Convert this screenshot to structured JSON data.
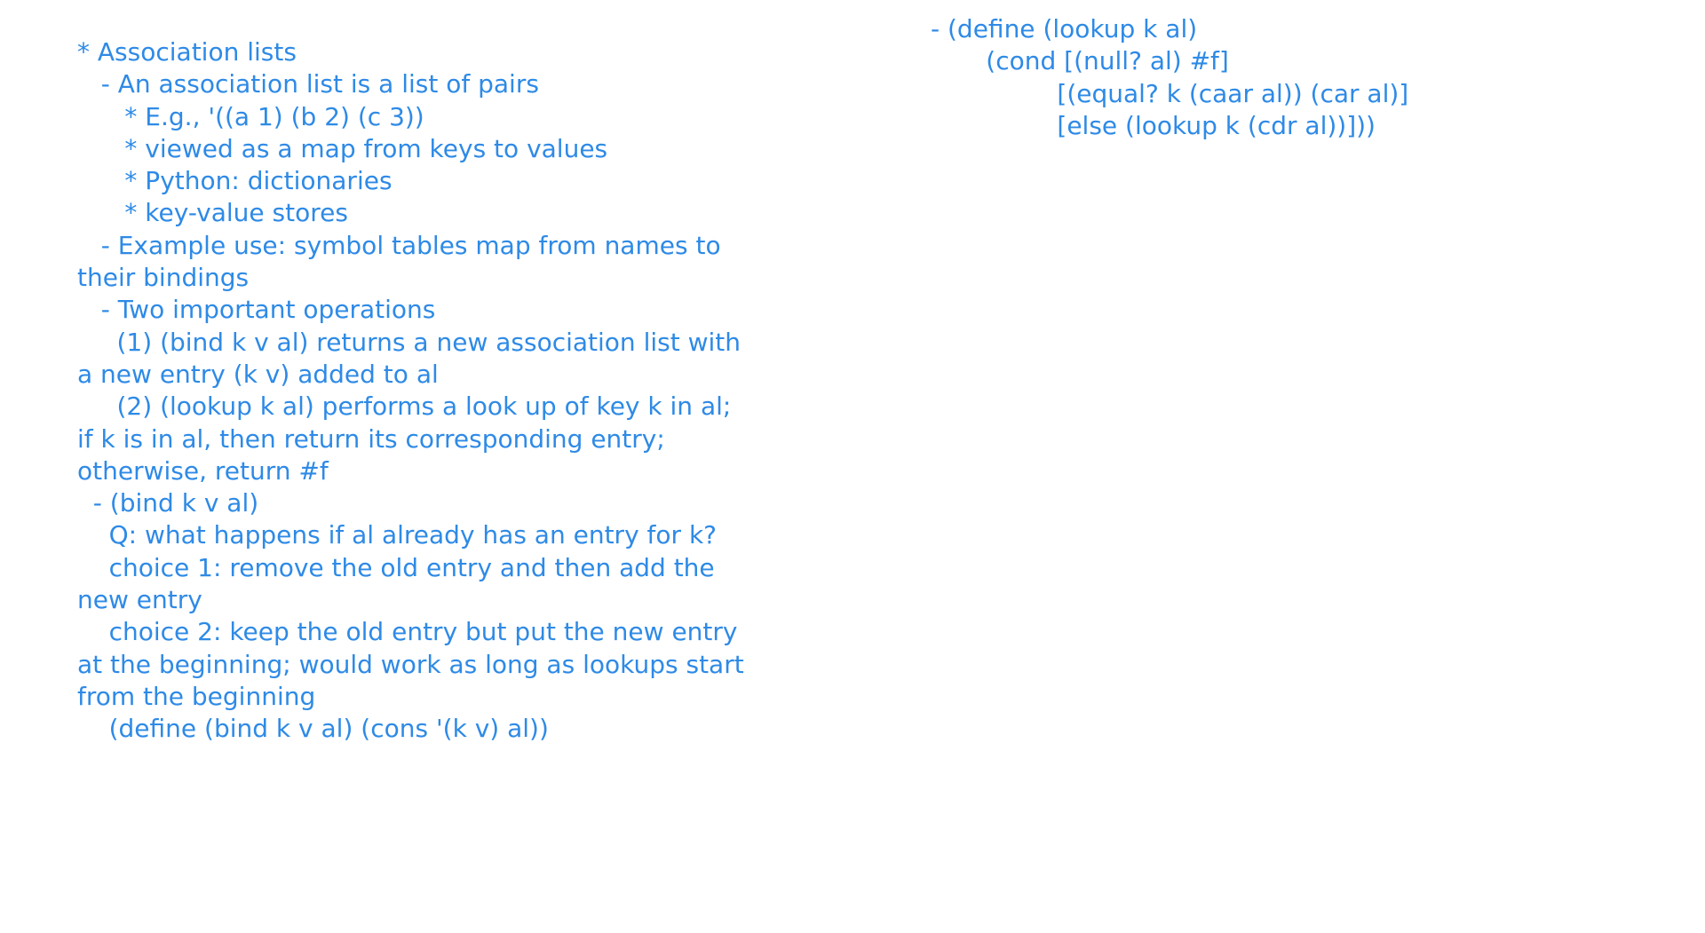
{
  "left_column": {
    "lines": [
      "* Association lists",
      "   - An association list is a list of pairs",
      "      * E.g., '((a 1) (b 2) (c 3))",
      "      * viewed as a map from keys to values",
      "      * Python: dictionaries",
      "      * key-value stores",
      "   - Example use: symbol tables map from names to",
      "their bindings",
      "   - Two important operations",
      "     (1) (bind k v al) returns a new association list with",
      "a new entry (k v) added to al",
      "     (2) (lookup k al) performs a look up of key k in al;",
      "if k is in al, then return its corresponding entry;",
      "otherwise, return #f",
      "  - (bind k v al)",
      "    Q: what happens if al already has an entry for k?",
      "    choice 1: remove the old entry and then add the",
      "new entry",
      "    choice 2: keep the old entry but put the new entry",
      "at the beginning; would work as long as lookups start",
      "from the beginning",
      "    (define (bind k v al) (cons '(k v) al))"
    ]
  },
  "right_column": {
    "lines": [
      "- (define (lookup k al)",
      "       (cond [(null? al) #f]",
      "                [(equal? k (caar al)) (car al)]",
      "                [else (lookup k (cdr al))]))"
    ]
  },
  "colors": {
    "text": "#2e8ae6",
    "background": "#ffffff"
  }
}
